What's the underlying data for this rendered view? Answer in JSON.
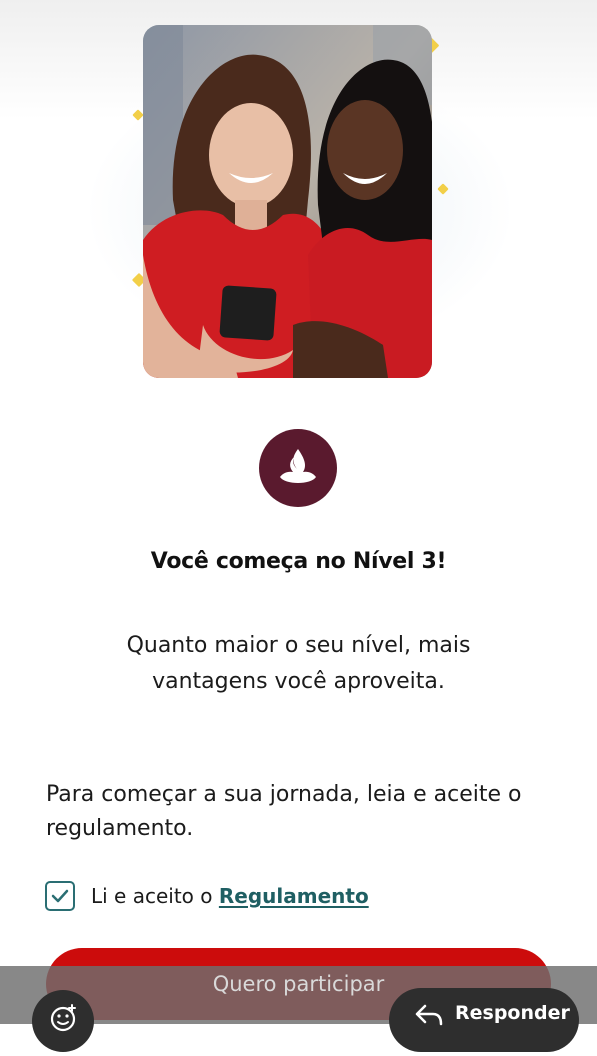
{
  "hero": {
    "image": "two-women-smiling-at-phone-photo"
  },
  "brand": {
    "icon": "flame-logo-icon",
    "color": "#5a1a2e"
  },
  "content": {
    "title": "Você começa no Nível 3!",
    "subtitle": "Quanto maior o seu nível, mais vantagens você aproveita.",
    "instruction": "Para começar a sua jornada, leia e aceite o regulamento."
  },
  "agreement": {
    "checked": true,
    "label_prefix": "Li e aceito o",
    "link_text": "Regulamento"
  },
  "cta": {
    "label": "Quero participar",
    "color": "#cc0c0c"
  },
  "overlay": {
    "emoji_icon": "emoji-add-icon",
    "reply_icon": "reply-arrow-icon",
    "reply_label": "Responder"
  },
  "colors": {
    "accent_teal": "#2a6e73",
    "sparkle": "#f2cf48"
  }
}
